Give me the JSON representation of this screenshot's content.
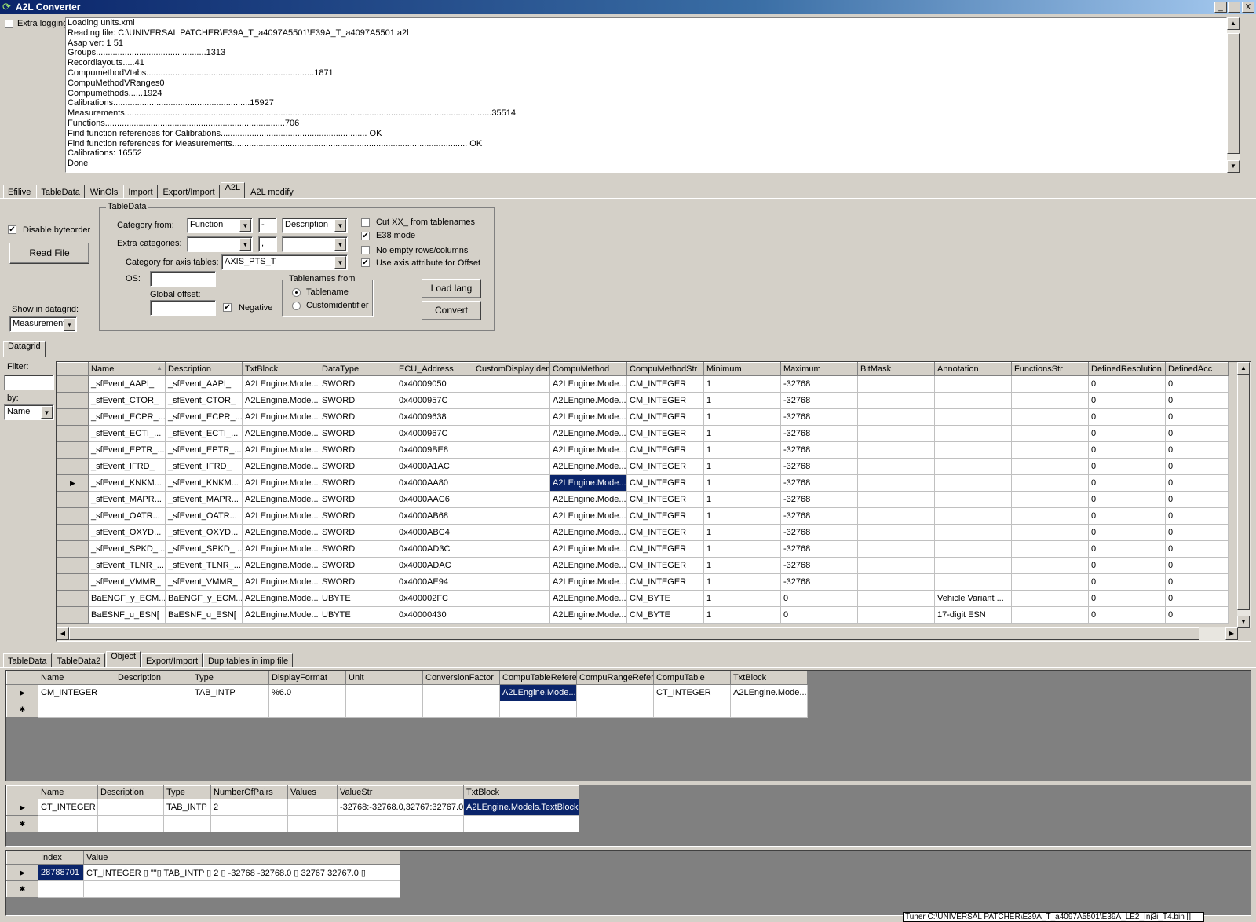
{
  "window": {
    "title": "A2L Converter",
    "btn_min": "_",
    "btn_max": "□",
    "btn_close": "X"
  },
  "extra_logging": {
    "label": "Extra logging",
    "checked": false
  },
  "log_lines": [
    "Loading units.xml",
    "Reading file: C:\\UNIVERSAL PATCHER\\E39A_T_a4097A5501\\E39A_T_a4097A5501.a2l",
    "Asap ver: 1 51",
    "Groups..............................................1313",
    "Recordlayouts.....41",
    "CompumethodVtabs......................................................................1871",
    "CompuMethodVRanges0",
    "Compumethods......1924",
    "Calibrations.........................................................15927",
    "Measurements.........................................................................................................................................................35514",
    "Functions...........................................................................706",
    "Find function references for Calibrations............................................................. OK",
    "Find function references for Measurements.................................................................................................. OK",
    "Calibrations: 16552",
    "Done"
  ],
  "main_tabs": [
    "Efilive",
    "TableData",
    "WinOls",
    "Import",
    "Export/Import",
    "A2L",
    "A2L modify"
  ],
  "main_tab_active": 5,
  "left_panel": {
    "disable_byteorder": {
      "label": "Disable byteorder",
      "checked": true
    },
    "read_file": "Read File",
    "show_in_datagrid_label": "Show in datagrid:",
    "show_in_datagrid_value": "Measurement"
  },
  "tabledata": {
    "title": "TableData",
    "category_from_label": "Category from:",
    "category_from_value": "Function",
    "sep1": "-",
    "desc_value": "Description",
    "extra_categories_label": "Extra categories:",
    "extra_cat_value": "",
    "sep2": ",",
    "extra_cat2_value": "",
    "axis_label": "Category for axis tables:",
    "axis_value": "AXIS_PTS_T",
    "os_label": "OS:",
    "os_value": "",
    "global_offset_label": "Global offset:",
    "global_offset_value": "",
    "negative": {
      "label": "Negative",
      "checked": true
    },
    "tablenames_from": {
      "title": "Tablenames from",
      "options": [
        "Tablename",
        "Customidentifier"
      ],
      "selected": 0
    },
    "checks": [
      {
        "label": "Cut XX_ from tablenames",
        "checked": false
      },
      {
        "label": "E38 mode",
        "checked": true
      },
      {
        "label": "No empty rows/columns",
        "checked": false
      },
      {
        "label": "Use axis attribute for Offset",
        "checked": true
      }
    ],
    "load_lang": "Load lang",
    "convert": "Convert"
  },
  "datagrid_tab": "Datagrid",
  "filter": {
    "label": "Filter:",
    "value": "",
    "by_label": "by:",
    "by_value": "Name"
  },
  "main_grid": {
    "columns": [
      "Name",
      "Description",
      "TxtBlock",
      "DataType",
      "ECU_Address",
      "CustomDisplayIden",
      "CompuMethod",
      "CompuMethodStr",
      "Minimum",
      "Maximum",
      "BitMask",
      "Annotation",
      "FunctionsStr",
      "DefinedResolution",
      "DefinedAcc"
    ],
    "sort_indicator": "▲",
    "rows": [
      [
        "_sfEvent_AAPI_",
        "_sfEvent_AAPI_",
        "A2LEngine.Mode...",
        "SWORD",
        "0x40009050",
        "",
        "A2LEngine.Mode...",
        "CM_INTEGER",
        "1",
        "-32768",
        "",
        "",
        "",
        "0",
        "0"
      ],
      [
        "_sfEvent_CTOR_",
        "_sfEvent_CTOR_",
        "A2LEngine.Mode...",
        "SWORD",
        "0x4000957C",
        "",
        "A2LEngine.Mode...",
        "CM_INTEGER",
        "1",
        "-32768",
        "",
        "",
        "",
        "0",
        "0"
      ],
      [
        "_sfEvent_ECPR_...",
        "_sfEvent_ECPR_...",
        "A2LEngine.Mode...",
        "SWORD",
        "0x40009638",
        "",
        "A2LEngine.Mode...",
        "CM_INTEGER",
        "1",
        "-32768",
        "",
        "",
        "",
        "0",
        "0"
      ],
      [
        "_sfEvent_ECTI_...",
        "_sfEvent_ECTI_...",
        "A2LEngine.Mode...",
        "SWORD",
        "0x4000967C",
        "",
        "A2LEngine.Mode...",
        "CM_INTEGER",
        "1",
        "-32768",
        "",
        "",
        "",
        "0",
        "0"
      ],
      [
        "_sfEvent_EPTR_...",
        "_sfEvent_EPTR_...",
        "A2LEngine.Mode...",
        "SWORD",
        "0x40009BE8",
        "",
        "A2LEngine.Mode...",
        "CM_INTEGER",
        "1",
        "-32768",
        "",
        "",
        "",
        "0",
        "0"
      ],
      [
        "_sfEvent_IFRD_",
        "_sfEvent_IFRD_",
        "A2LEngine.Mode...",
        "SWORD",
        "0x4000A1AC",
        "",
        "A2LEngine.Mode...",
        "CM_INTEGER",
        "1",
        "-32768",
        "",
        "",
        "",
        "0",
        "0"
      ],
      [
        "_sfEvent_KNKM...",
        "_sfEvent_KNKM...",
        "A2LEngine.Mode...",
        "SWORD",
        "0x4000AA80",
        "",
        "A2LEngine.Mode...",
        "CM_INTEGER",
        "1",
        "-32768",
        "",
        "",
        "",
        "0",
        "0"
      ],
      [
        "_sfEvent_MAPR...",
        "_sfEvent_MAPR...",
        "A2LEngine.Mode...",
        "SWORD",
        "0x4000AAC6",
        "",
        "A2LEngine.Mode...",
        "CM_INTEGER",
        "1",
        "-32768",
        "",
        "",
        "",
        "0",
        "0"
      ],
      [
        "_sfEvent_OATR...",
        "_sfEvent_OATR...",
        "A2LEngine.Mode...",
        "SWORD",
        "0x4000AB68",
        "",
        "A2LEngine.Mode...",
        "CM_INTEGER",
        "1",
        "-32768",
        "",
        "",
        "",
        "0",
        "0"
      ],
      [
        "_sfEvent_OXYD...",
        "_sfEvent_OXYD...",
        "A2LEngine.Mode...",
        "SWORD",
        "0x4000ABC4",
        "",
        "A2LEngine.Mode...",
        "CM_INTEGER",
        "1",
        "-32768",
        "",
        "",
        "",
        "0",
        "0"
      ],
      [
        "_sfEvent_SPKD_...",
        "_sfEvent_SPKD_...",
        "A2LEngine.Mode...",
        "SWORD",
        "0x4000AD3C",
        "",
        "A2LEngine.Mode...",
        "CM_INTEGER",
        "1",
        "-32768",
        "",
        "",
        "",
        "0",
        "0"
      ],
      [
        "_sfEvent_TLNR_...",
        "_sfEvent_TLNR_...",
        "A2LEngine.Mode...",
        "SWORD",
        "0x4000ADAC",
        "",
        "A2LEngine.Mode...",
        "CM_INTEGER",
        "1",
        "-32768",
        "",
        "",
        "",
        "0",
        "0"
      ],
      [
        "_sfEvent_VMMR_",
        "_sfEvent_VMMR_",
        "A2LEngine.Mode...",
        "SWORD",
        "0x4000AE94",
        "",
        "A2LEngine.Mode...",
        "CM_INTEGER",
        "1",
        "-32768",
        "",
        "",
        "",
        "0",
        "0"
      ],
      [
        "BaENGF_y_ECM...",
        "BaENGF_y_ECM...",
        "A2LEngine.Mode...",
        "UBYTE",
        "0x400002FC",
        "",
        "A2LEngine.Mode...",
        "CM_BYTE",
        "1",
        "0",
        "",
        "Vehicle Variant ...",
        "",
        "0",
        "0"
      ],
      [
        "BaESNF_u_ESN[",
        "BaESNF_u_ESN[",
        "A2LEngine.Mode...",
        "UBYTE",
        "0x40000430",
        "",
        "A2LEngine.Mode...",
        "CM_BYTE",
        "1",
        "0",
        "",
        "17-digit ESN",
        "",
        "0",
        "0"
      ]
    ],
    "current_row": 6,
    "selected_cell": [
      6,
      6
    ]
  },
  "lower_tabs": [
    "TableData",
    "TableData2",
    "Object",
    "Export/Import",
    "Dup tables in imp file"
  ],
  "lower_tab_active": 2,
  "grid1": {
    "columns": [
      "Name",
      "Description",
      "Type",
      "DisplayFormat",
      "Unit",
      "ConversionFactor",
      "CompuTableRefere",
      "CompuRangeRefer",
      "CompuTable",
      "TxtBlock"
    ],
    "rows": [
      [
        "CM_INTEGER",
        "",
        "TAB_INTP",
        "%6.0",
        "",
        "",
        "A2LEngine.Mode...",
        "",
        "CT_INTEGER",
        "A2LEngine.Mode..."
      ]
    ],
    "selected_col": 6
  },
  "grid2": {
    "columns": [
      "Name",
      "Description",
      "Type",
      "NumberOfPairs",
      "Values",
      "ValueStr",
      "TxtBlock"
    ],
    "rows": [
      [
        "CT_INTEGER",
        "",
        "TAB_INTP",
        "2",
        "",
        "-32768:-32768.0,32767:32767.0",
        "A2LEngine.Models.TextBlock"
      ]
    ],
    "selected_col": 6
  },
  "grid3": {
    "columns": [
      "Index",
      "Value"
    ],
    "rows": [
      [
        "28788701",
        "CT_INTEGER ▯  \"\"▯  TAB_INTP ▯  2 ▯  -32768 -32768.0 ▯  32767 32767.0 ▯"
      ]
    ],
    "selected_col": 0
  },
  "status_text": "Tuner C:\\UNIVERSAL PATCHER\\E39A_T_a4097A5501\\E39A_LE2_Inj3i_T4.bin []"
}
